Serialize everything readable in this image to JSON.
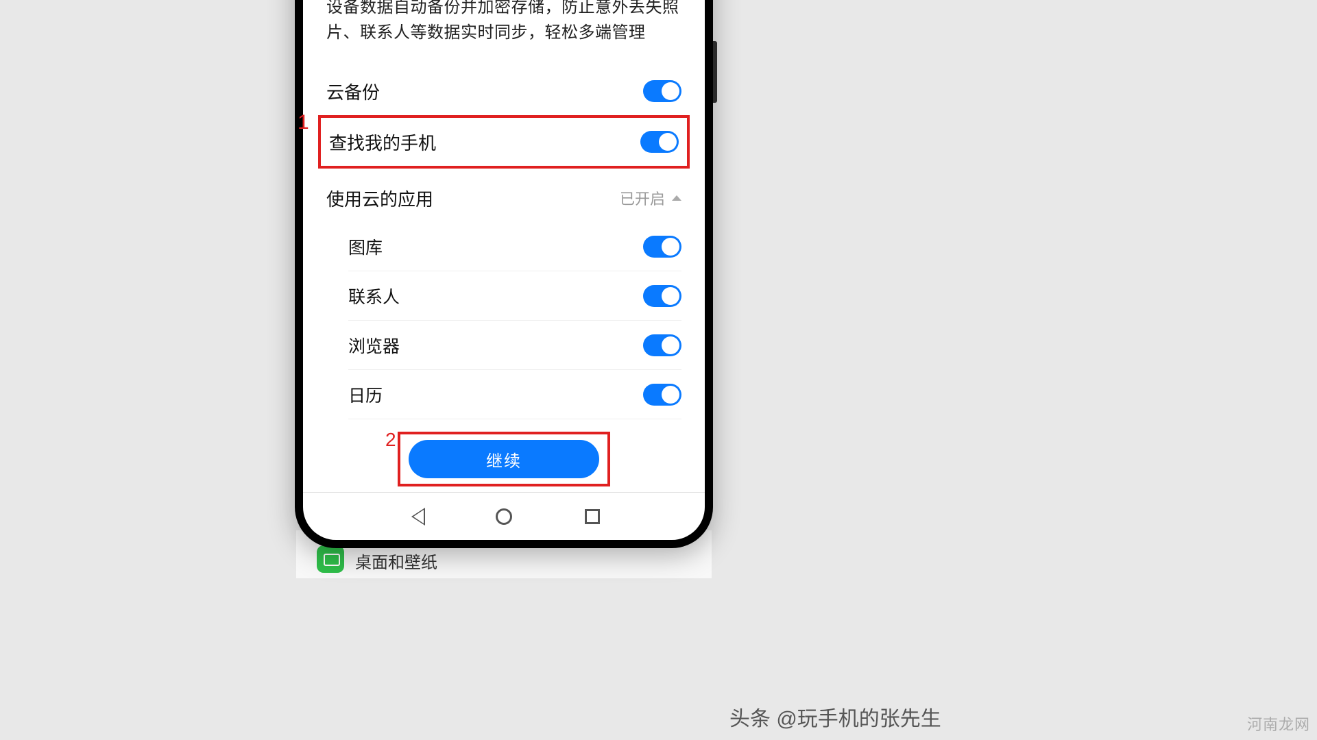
{
  "description": "设备数据自动备份并加密存储，防止意外丢失照片、联系人等数据实时同步，轻松多端管理",
  "toggles": {
    "cloud_backup": "云备份",
    "find_my_phone": "查找我的手机"
  },
  "cloud_apps": {
    "title": "使用云的应用",
    "status": "已开启",
    "items": {
      "gallery": "图库",
      "contacts": "联系人",
      "browser": "浏览器",
      "calendar": "日历"
    }
  },
  "continue_label": "继续",
  "annot": {
    "a1": "1",
    "a2": "2"
  },
  "behind_label": "桌面和壁纸",
  "watermark_center": "头条 @玩手机的张先生",
  "watermark_right": "河南龙网"
}
